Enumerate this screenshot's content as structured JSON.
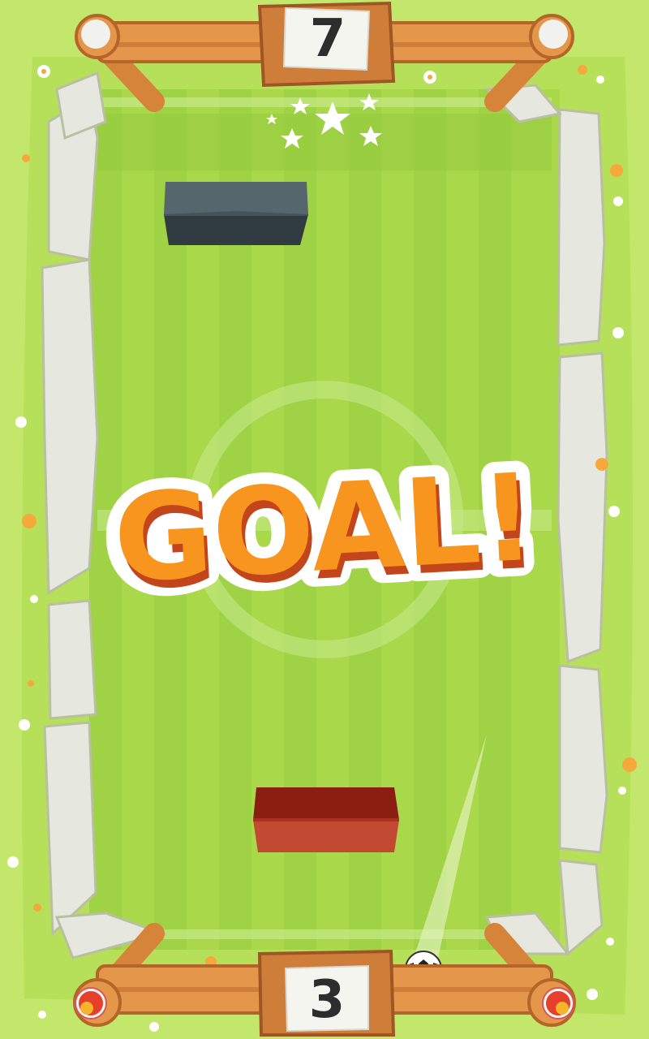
{
  "scoreboard": {
    "top_score": "7",
    "bottom_score": "3"
  },
  "banner": {
    "text": "GOAL!"
  },
  "colors": {
    "grass_light": "#a9d84a",
    "grass_stripe": "#9fd244",
    "outer_grass": "#c3e86c",
    "wood": "#e4964a",
    "top_paddle": "#3b4a50",
    "bottom_paddle": "#b8402e",
    "goal_text_fill": "#f7951f",
    "goal_text_shadow": "#c2451b"
  },
  "icons": {
    "ball": "soccer-ball-icon",
    "flag_left": "fire-orb-icon",
    "flag_right": "fire-orb-icon",
    "celebration": "stars-icon"
  }
}
